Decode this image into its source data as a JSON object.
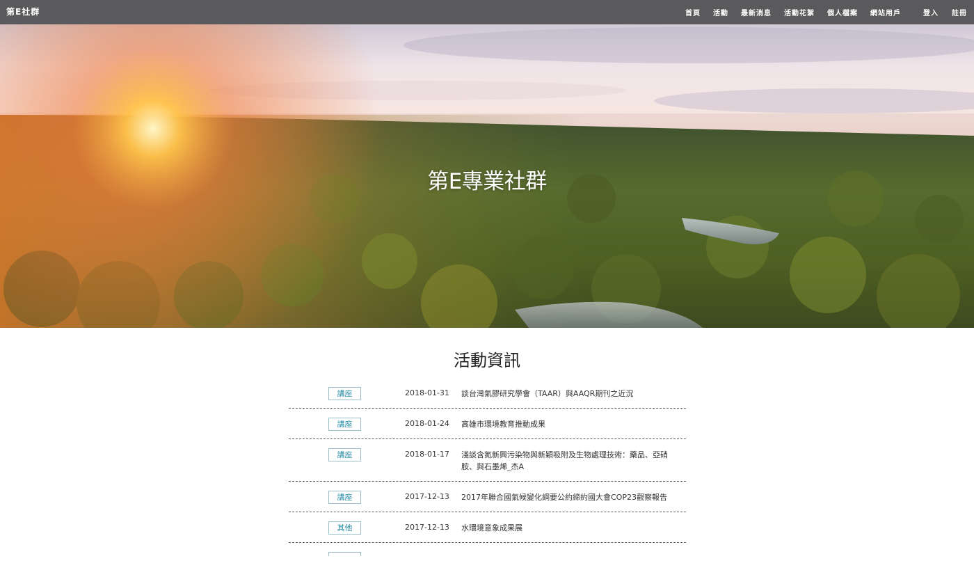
{
  "nav": {
    "brand": "第E社群",
    "links": [
      "首頁",
      "活動",
      "最新消息",
      "活動花絮",
      "個人檔案",
      "網站用戶"
    ],
    "auth": [
      "登入",
      "註冊"
    ]
  },
  "hero": {
    "title": "第E專業社群"
  },
  "events": {
    "heading": "活動資訊",
    "items": [
      {
        "tag": "講座",
        "date": "2018-01-31",
        "title": "談台灣氣膠研究學會（TAAR）與AAQR期刊之近況"
      },
      {
        "tag": "講座",
        "date": "2018-01-24",
        "title": "高雄市環境教育推動成果"
      },
      {
        "tag": "講座",
        "date": "2018-01-17",
        "title": "淺談含氮新興污染物與新穎吸附及生物處理技術：藥品、亞硝胺、與石墨烯_杰A"
      },
      {
        "tag": "講座",
        "date": "2017-12-13",
        "title": "2017年聯合國氣候變化綱要公約締約國大會COP23觀察報告"
      },
      {
        "tag": "其他",
        "date": "2017-12-13",
        "title": "水環境意象成果展"
      }
    ]
  },
  "colors": {
    "nav_bg": "#5a5a5c",
    "tag_text": "#2d8fa8",
    "tag_border": "#9bbfc9"
  }
}
